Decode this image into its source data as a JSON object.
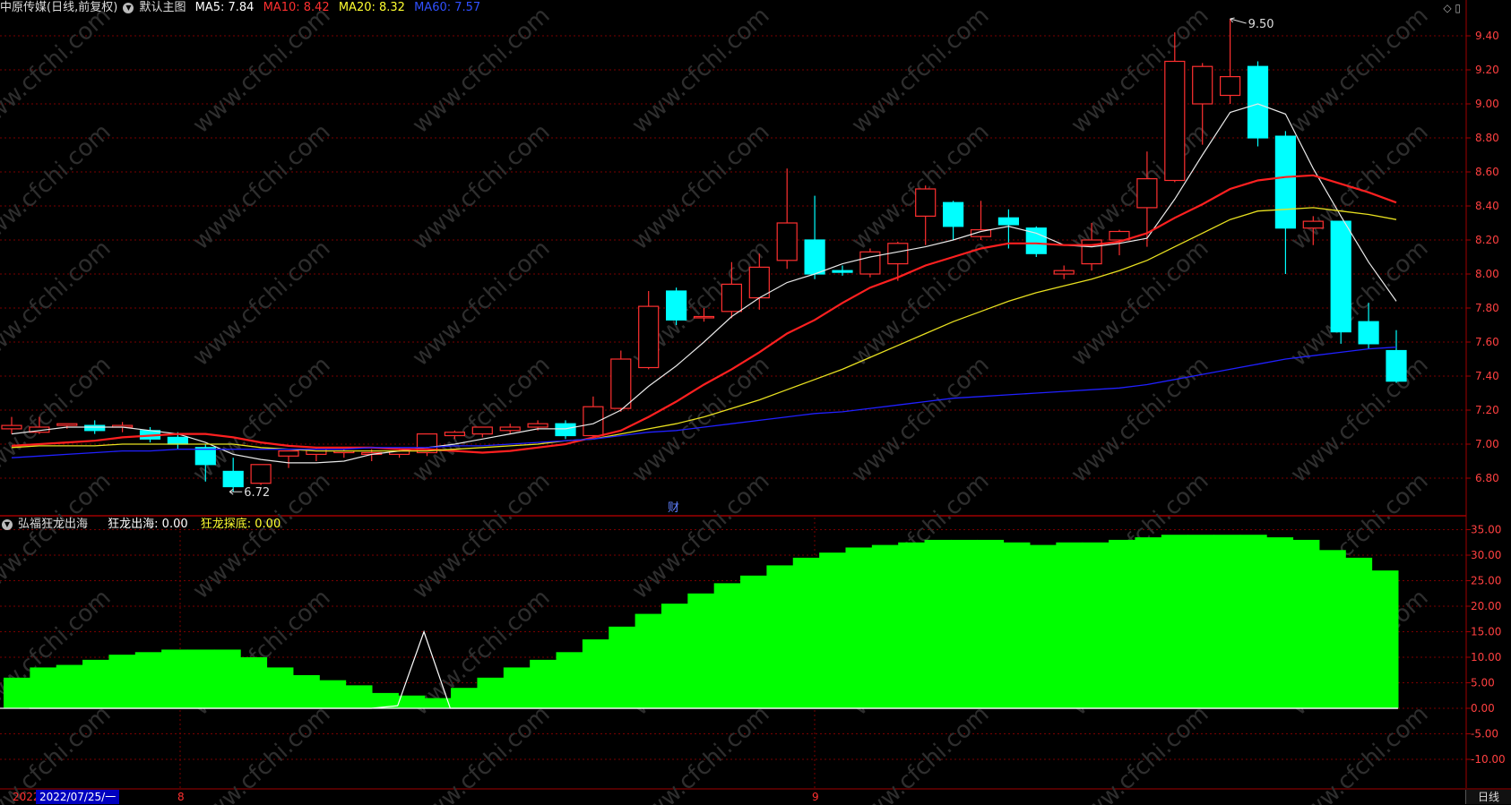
{
  "main_header": {
    "stock_name": "中原传媒",
    "mode": "(日线,前复权)",
    "chart_name": "默认主图",
    "ma5_label": "MA5: 7.84",
    "ma10_label": "MA10: 8.42",
    "ma20_label": "MA20: 8.32",
    "ma60_label": "MA60: 7.57",
    "icons": "◇ ▯"
  },
  "sub_header": {
    "indicator_name": "弘福狂龙出海",
    "line1_label": "狂龙出海: 0.00",
    "line2_label": "狂龙探底: 0.00"
  },
  "annotations": {
    "high_label": "9.50",
    "low_label": "6.72",
    "finance_marker": "财"
  },
  "bottom": {
    "date_prefix": "2022",
    "date_cursor": "2022/07/25/一",
    "month_8": "8",
    "month_9": "9",
    "period": "日线"
  },
  "watermark": "www.cfchi.com",
  "colors": {
    "up": "#ff3030",
    "down": "#00ffff",
    "ma5": "#e8e8e8",
    "ma10": "#ff2020",
    "ma20": "#e8e020",
    "ma60": "#2020ff",
    "hist": "#00ff00",
    "grid": "#7a0000"
  },
  "chart_data": [
    {
      "type": "candlestick",
      "title": "中原传媒 (日线,前复权)",
      "ylim": [
        6.6,
        9.5
      ],
      "yticks": [
        6.8,
        7.0,
        7.2,
        7.4,
        7.6,
        7.8,
        8.0,
        8.2,
        8.4,
        8.6,
        8.8,
        9.0,
        9.2,
        9.4
      ],
      "ohlc": [
        [
          7.09,
          7.16,
          7.06,
          7.11
        ],
        [
          7.07,
          7.16,
          7.06,
          7.1
        ],
        [
          7.11,
          7.12,
          7.09,
          7.12
        ],
        [
          7.11,
          7.14,
          7.06,
          7.08
        ],
        [
          7.1,
          7.13,
          7.07,
          7.11
        ],
        [
          7.08,
          7.1,
          7.01,
          7.03
        ],
        [
          7.04,
          7.07,
          6.97,
          7.0
        ],
        [
          6.98,
          7.0,
          6.78,
          6.88
        ],
        [
          6.84,
          6.92,
          6.72,
          6.75
        ],
        [
          6.77,
          6.88,
          6.76,
          6.88
        ],
        [
          6.93,
          6.95,
          6.86,
          6.96
        ],
        [
          6.94,
          6.98,
          6.9,
          6.97
        ],
        [
          6.95,
          6.97,
          6.92,
          6.96
        ],
        [
          6.94,
          6.97,
          6.9,
          6.95
        ],
        [
          6.94,
          6.98,
          6.92,
          6.96
        ],
        [
          6.95,
          7.06,
          6.93,
          7.06
        ],
        [
          7.05,
          7.08,
          7.03,
          7.07
        ],
        [
          7.06,
          7.1,
          7.04,
          7.1
        ],
        [
          7.08,
          7.12,
          7.06,
          7.1
        ],
        [
          7.1,
          7.14,
          7.08,
          7.12
        ],
        [
          7.12,
          7.14,
          7.03,
          7.05
        ],
        [
          7.05,
          7.28,
          7.03,
          7.22
        ],
        [
          7.21,
          7.55,
          7.19,
          7.5
        ],
        [
          7.45,
          7.9,
          7.44,
          7.81
        ],
        [
          7.9,
          7.92,
          7.7,
          7.73
        ],
        [
          7.75,
          7.8,
          7.72,
          7.75
        ],
        [
          7.78,
          8.07,
          7.74,
          7.94
        ],
        [
          7.86,
          8.12,
          7.79,
          8.04
        ],
        [
          8.08,
          8.62,
          8.03,
          8.3
        ],
        [
          8.2,
          8.46,
          7.97,
          8.0
        ],
        [
          8.02,
          8.05,
          7.99,
          8.01
        ],
        [
          8.0,
          8.15,
          7.98,
          8.13
        ],
        [
          8.06,
          8.19,
          7.96,
          8.18
        ],
        [
          8.34,
          8.52,
          8.17,
          8.5
        ],
        [
          8.42,
          8.43,
          8.2,
          8.28
        ],
        [
          8.22,
          8.43,
          8.2,
          8.26
        ],
        [
          8.33,
          8.38,
          8.15,
          8.29
        ],
        [
          8.27,
          8.28,
          8.1,
          8.12
        ],
        [
          8.0,
          8.05,
          7.97,
          8.02
        ],
        [
          8.06,
          8.3,
          8.02,
          8.2
        ],
        [
          8.2,
          8.26,
          8.11,
          8.25
        ],
        [
          8.39,
          8.72,
          8.16,
          8.56
        ],
        [
          8.55,
          9.42,
          8.54,
          9.25
        ],
        [
          9.0,
          9.24,
          8.76,
          9.22
        ],
        [
          9.05,
          9.5,
          9.0,
          9.16
        ],
        [
          9.22,
          9.25,
          8.75,
          8.8
        ],
        [
          8.81,
          8.84,
          8.0,
          8.27
        ],
        [
          8.27,
          8.34,
          8.17,
          8.31
        ],
        [
          8.31,
          8.31,
          7.59,
          7.66
        ],
        [
          7.72,
          7.83,
          7.56,
          7.59
        ],
        [
          7.55,
          7.67,
          7.36,
          7.37
        ]
      ],
      "series": [
        {
          "name": "MA5",
          "values": [
            7.06,
            7.08,
            7.1,
            7.1,
            7.1,
            7.08,
            7.06,
            7.01,
            6.94,
            6.91,
            6.89,
            6.89,
            6.9,
            6.94,
            6.96,
            6.98,
            7.0,
            7.03,
            7.06,
            7.09,
            7.09,
            7.12,
            7.2,
            7.34,
            7.46,
            7.6,
            7.75,
            7.86,
            7.95,
            8.0,
            8.06,
            8.1,
            8.13,
            8.16,
            8.2,
            8.25,
            8.28,
            8.24,
            8.17,
            8.16,
            8.18,
            8.21,
            8.44,
            8.7,
            8.95,
            9.0,
            8.94,
            8.62,
            8.34,
            8.07,
            7.84
          ]
        },
        {
          "name": "MA10",
          "values": [
            6.99,
            7.0,
            7.01,
            7.02,
            7.04,
            7.05,
            7.06,
            7.06,
            7.04,
            7.01,
            6.99,
            6.98,
            6.98,
            6.98,
            6.97,
            6.97,
            6.96,
            6.95,
            6.96,
            6.98,
            7.0,
            7.04,
            7.08,
            7.16,
            7.25,
            7.35,
            7.44,
            7.54,
            7.65,
            7.73,
            7.83,
            7.92,
            7.98,
            8.05,
            8.1,
            8.15,
            8.18,
            8.18,
            8.17,
            8.17,
            8.19,
            8.24,
            8.33,
            8.41,
            8.5,
            8.55,
            8.57,
            8.58,
            8.53,
            8.48,
            8.42
          ]
        },
        {
          "name": "MA20",
          "values": [
            6.98,
            6.99,
            6.99,
            6.99,
            7.0,
            7.0,
            7.0,
            7.0,
            7.0,
            6.98,
            6.97,
            6.96,
            6.96,
            6.96,
            6.96,
            6.96,
            6.97,
            6.98,
            6.99,
            7.0,
            7.02,
            7.03,
            7.06,
            7.09,
            7.12,
            7.16,
            7.21,
            7.26,
            7.32,
            7.38,
            7.44,
            7.51,
            7.58,
            7.65,
            7.72,
            7.78,
            7.84,
            7.89,
            7.93,
            7.97,
            8.02,
            8.08,
            8.16,
            8.24,
            8.32,
            8.37,
            8.38,
            8.39,
            8.37,
            8.35,
            8.32
          ]
        },
        {
          "name": "MA60",
          "values": [
            6.92,
            6.93,
            6.94,
            6.95,
            6.96,
            6.96,
            6.97,
            6.97,
            6.97,
            6.97,
            6.97,
            6.97,
            6.97,
            6.98,
            6.98,
            6.98,
            6.99,
            6.99,
            7.0,
            7.01,
            7.02,
            7.03,
            7.05,
            7.07,
            7.08,
            7.1,
            7.12,
            7.14,
            7.16,
            7.18,
            7.19,
            7.21,
            7.23,
            7.25,
            7.27,
            7.28,
            7.29,
            7.3,
            7.31,
            7.32,
            7.33,
            7.35,
            7.38,
            7.41,
            7.44,
            7.47,
            7.5,
            7.52,
            7.54,
            7.56,
            7.57
          ]
        }
      ]
    },
    {
      "type": "bar",
      "title": "弘福狂龙出海",
      "ylim": [
        -15,
        35
      ],
      "yticks": [
        -10.0,
        -5.0,
        0.0,
        5.0,
        10.0,
        15.0,
        20.0,
        25.0,
        30.0,
        35.0
      ],
      "series": [
        {
          "name": "histogram",
          "values": [
            6,
            8,
            8.5,
            9.5,
            10.5,
            11,
            11.5,
            11.5,
            11.5,
            10,
            8,
            6.5,
            5.5,
            4.5,
            3,
            2.5,
            2,
            4,
            6,
            8,
            9.5,
            11,
            13.5,
            16,
            18.5,
            20.5,
            22.5,
            24.5,
            26,
            28,
            29.5,
            30.5,
            31.5,
            32,
            32.5,
            33,
            33,
            33,
            32.5,
            32,
            32.5,
            32.5,
            33,
            33.5,
            34,
            34,
            34,
            34,
            33.5,
            33,
            31,
            29.5,
            27
          ]
        },
        {
          "name": "狂龙出海",
          "values": [
            0,
            0,
            0,
            0,
            0,
            0,
            0,
            0,
            0,
            0,
            0,
            0,
            0,
            0,
            0.5,
            15,
            0,
            0,
            0,
            0,
            0,
            0,
            0,
            0,
            0,
            0,
            0,
            0,
            0,
            0,
            0,
            0,
            0,
            0,
            0,
            0,
            0,
            0,
            0,
            0,
            0,
            0,
            0,
            0,
            0,
            0,
            0,
            0,
            0,
            0,
            0,
            0,
            0
          ]
        }
      ]
    }
  ]
}
